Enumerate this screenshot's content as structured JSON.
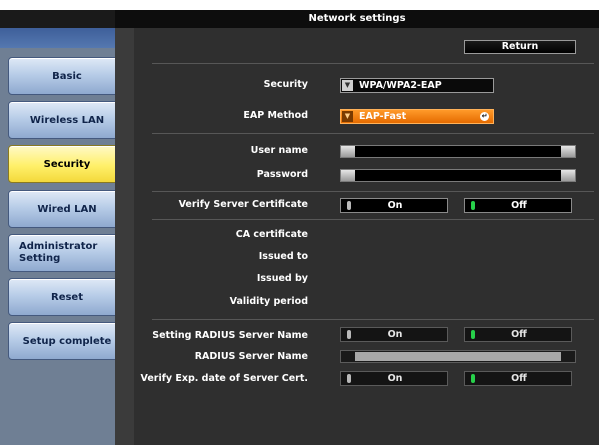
{
  "window": {
    "title": "Network settings"
  },
  "toolbar": {
    "return_label": "Return"
  },
  "sidebar": {
    "items": [
      {
        "label": "Basic",
        "active": false
      },
      {
        "label": "Wireless LAN",
        "active": false
      },
      {
        "label": "Security",
        "active": true
      },
      {
        "label": "Wired LAN",
        "active": false
      },
      {
        "label_line1": "Administrator",
        "label_line2": "Setting",
        "active": false
      },
      {
        "label": "Reset",
        "active": false
      },
      {
        "label": "Setup complete",
        "active": false
      }
    ]
  },
  "form": {
    "security": {
      "label": "Security",
      "value": "WPA/WPA2-EAP"
    },
    "eap_method": {
      "label": "EAP Method",
      "value": "EAP-Fast"
    },
    "user_name": {
      "label": "User name",
      "value": ""
    },
    "password": {
      "label": "Password",
      "value": ""
    },
    "verify_server_certificate": {
      "label": "Verify Server Certificate",
      "on_label": "On",
      "off_label": "Off",
      "selected": "Off"
    },
    "ca_certificate": {
      "label": "CA certificate"
    },
    "issued_to": {
      "label": "Issued to"
    },
    "issued_by": {
      "label": "Issued by"
    },
    "validity_period": {
      "label": "Validity period"
    },
    "setting_radius_server_name": {
      "label": "Setting RADIUS Server Name",
      "on_label": "On",
      "off_label": "Off",
      "selected": "Off"
    },
    "radius_server_name": {
      "label": "RADIUS Server Name",
      "value": ""
    },
    "verify_exp_date": {
      "label": "Verify Exp. date of Server Cert.",
      "on_label": "On",
      "off_label": "Off",
      "selected": "Off"
    }
  },
  "colors": {
    "accent": "#ff8a14",
    "active_tab": "#fff06a",
    "panel_bg": "#2f2f2f",
    "toggle_selected": "#27d04a"
  }
}
